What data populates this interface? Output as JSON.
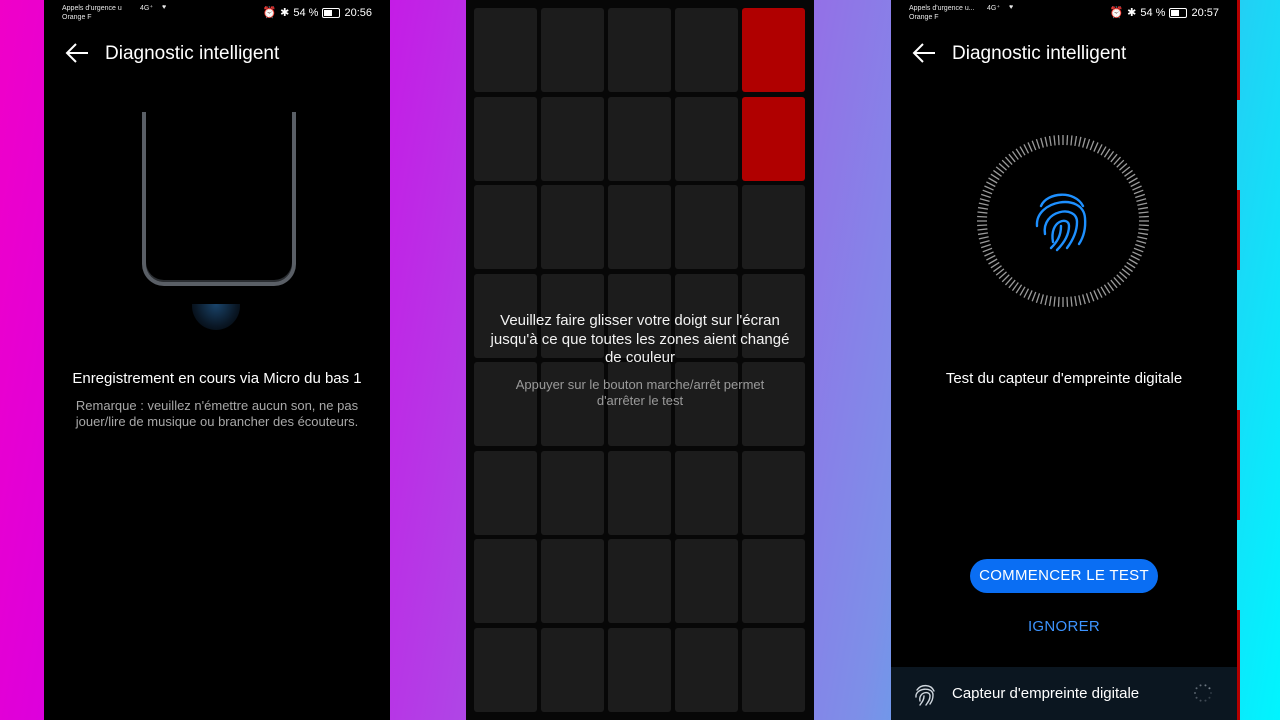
{
  "screens": {
    "left": {
      "status": {
        "carrier_line1": "Appels d'urgence u",
        "carrier_line2": "Orange F",
        "network": "4G⁺",
        "battery": "54 %",
        "time": "20:56"
      },
      "title": "Diagnostic intelligent",
      "message": "Enregistrement en cours via Micro du bas 1",
      "note": "Remarque : veuillez n'émettre aucun son, ne pas jouer/lire de musique ou brancher des écouteurs."
    },
    "middle": {
      "grid": {
        "columns": 5,
        "rows": 8,
        "red_cells": [
          [
            0,
            4
          ],
          [
            1,
            4
          ]
        ]
      },
      "instruction": "Veuillez faire glisser votre doigt sur l'écran jusqu'à ce que toutes les zones aient changé de couleur",
      "hint": "Appuyer sur le bouton marche/arrêt permet d'arrêter le test"
    },
    "right": {
      "status": {
        "carrier_line1": "Appels d'urgence u...",
        "carrier_line2": "Orange F",
        "network": "4G⁺",
        "battery": "54 %",
        "time": "20:57"
      },
      "title": "Diagnostic intelligent",
      "test_title": "Test du capteur d'empreinte digitale",
      "start_button": "COMMENCER LE TEST",
      "ignore_link": "IGNORER",
      "bottom_item": "Capteur d'empreinte digitale"
    }
  },
  "colors": {
    "accent_blue": "#0a6ef3",
    "link_blue": "#3d94ff",
    "red_cell": "#b00000"
  },
  "icons": [
    "back-arrow-icon",
    "alarm-icon",
    "bluetooth-icon",
    "battery-icon",
    "heart-icon",
    "fingerprint-icon",
    "spinner-icon"
  ]
}
